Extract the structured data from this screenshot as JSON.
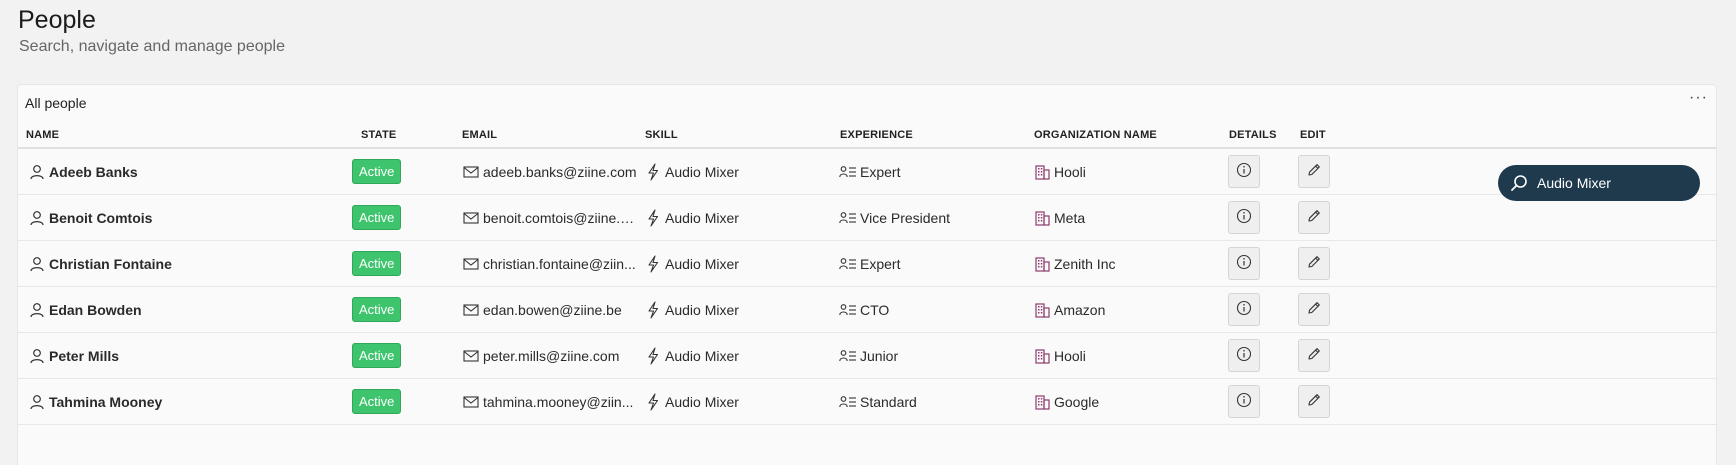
{
  "page": {
    "title": "People",
    "subtitle": "Search, navigate and manage people"
  },
  "card": {
    "title": "All people",
    "more_label": "···"
  },
  "columns": {
    "name": "NAME",
    "state": "STATE",
    "email": "EMAIL",
    "skill": "SKILL",
    "experience": "EXPERIENCE",
    "organization": "ORGANIZATION NAME",
    "details": "DETAILS",
    "edit": "EDIT"
  },
  "rows": [
    {
      "name": "Adeeb Banks",
      "state": "Active",
      "email": "adeeb.banks@ziine.com",
      "skill": "Audio Mixer",
      "experience": "Expert",
      "organization": "Hooli"
    },
    {
      "name": "Benoit Comtois",
      "state": "Active",
      "email": "benoit.comtois@ziine.c...",
      "skill": "Audio Mixer",
      "experience": "Vice President",
      "organization": "Meta"
    },
    {
      "name": "Christian Fontaine",
      "state": "Active",
      "email": "christian.fontaine@ziin...",
      "skill": "Audio Mixer",
      "experience": "Expert",
      "organization": "Zenith Inc"
    },
    {
      "name": "Edan Bowden",
      "state": "Active",
      "email": "edan.bowen@ziine.be",
      "skill": "Audio Mixer",
      "experience": "CTO",
      "organization": "Amazon"
    },
    {
      "name": "Peter Mills",
      "state": "Active",
      "email": "peter.mills@ziine.com",
      "skill": "Audio Mixer",
      "experience": "Junior",
      "organization": "Hooli"
    },
    {
      "name": "Tahmina Mooney",
      "state": "Active",
      "email": "tahmina.mooney@ziin...",
      "skill": "Audio Mixer",
      "experience": "Standard",
      "organization": "Google"
    }
  ],
  "search": {
    "value": "Audio Mixer"
  },
  "colors": {
    "active_badge": "#3ec46d",
    "search_pill": "#1e3a4c",
    "org_icon": "#8e3b6e"
  },
  "icons": {
    "name": "person-icon",
    "email": "mail-icon",
    "skill": "lightning-icon",
    "experience": "experience-list-icon",
    "organization": "building-icon",
    "details": "info-icon",
    "edit": "pencil-icon",
    "search": "search-icon"
  }
}
